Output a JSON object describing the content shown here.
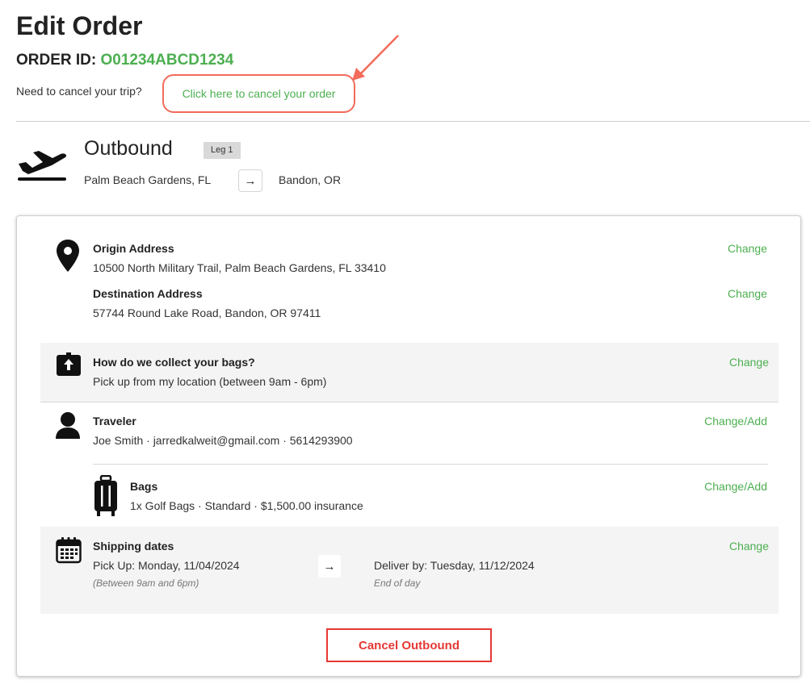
{
  "page": {
    "title": "Edit Order",
    "order_id_label": "ORDER ID:",
    "order_id_value": "O01234ABCD1234",
    "cancel_prompt": "Need to cancel your trip?",
    "cancel_link": "Click here to cancel your order"
  },
  "leg": {
    "title": "Outbound",
    "badge": "Leg 1",
    "from": "Palm Beach Gardens, FL",
    "arrow": "→",
    "to": "Bandon, OR"
  },
  "card": {
    "origin": {
      "label": "Origin Address",
      "value": "10500 North Military Trail, Palm Beach Gardens, FL 33410",
      "action": "Change"
    },
    "destination": {
      "label": "Destination Address",
      "value": "57744 Round Lake Road, Bandon, OR 97411",
      "action": "Change"
    },
    "collection": {
      "label": "How do we collect your bags?",
      "value": "Pick up from my location (between 9am - 6pm)",
      "action": "Change"
    },
    "traveler": {
      "label": "Traveler",
      "value": "Joe Smith · jarredkalweit@gmail.com · 5614293900",
      "action": "Change/Add"
    },
    "bags": {
      "label": "Bags",
      "value": "1x Golf Bags · Standard · $1,500.00 insurance",
      "action": "Change/Add"
    },
    "shipping": {
      "label": "Shipping dates",
      "pickup": "Pick Up: Monday, 11/04/2024",
      "pickup_sub": "(Between 9am and 6pm)",
      "arrow": "→",
      "deliver": "Deliver by: Tuesday, 11/12/2024",
      "deliver_sub": "End of day",
      "action": "Change"
    },
    "cancel_button": "Cancel Outbound"
  },
  "colors": {
    "accent_green": "#4caf50",
    "annotation_red": "#f26b5b",
    "cancel_red": "#e53935"
  },
  "icons": [
    "plane-departure-icon",
    "map-pin-icon",
    "bag-pickup-icon",
    "person-icon",
    "luggage-icon",
    "calendar-icon"
  ]
}
